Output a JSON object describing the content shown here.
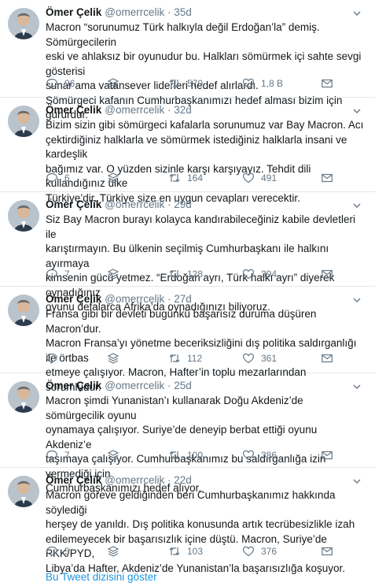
{
  "colors": {
    "link": "#1b95e0",
    "muted": "#657786",
    "text": "#14171a",
    "divider": "#e1e8ed"
  },
  "icons": {
    "reply": "reply-icon",
    "share": "stack-share-icon",
    "retweet": "retweet-icon",
    "like": "heart-icon",
    "message": "envelope-icon",
    "menu": "chevron-down-icon"
  },
  "tweets": [
    {
      "name": "Ömer Çelik",
      "handle": "@omerrcelik",
      "time": "35d",
      "text": "Macron “sorunumuz Türk halkıyla değil Erdoğan’la” demiş.  Sömürgecilerin\neski ve ahlaksız bir oyunudur bu. Halkları sömürmek içi sahte sevgi gösterisi\nsunar  ama vatansever liderleri hedef alırlardı.\nSömürgeci kafanın Cumhurbaşkanımızı hedef alması bizim için gururdur.",
      "replies": "96",
      "retweets": "570",
      "likes": "1,8 B"
    },
    {
      "name": "Ömer Çelik",
      "handle": "@omerrcelik",
      "time": "32d",
      "text": "Bizim sizin gibi sömürgeci kafalarla sorunumuz var Bay Macron. Acı\nçektirdiğiniz halklarla ve sömürmek istediğiniz halklarla insani ve kardeşlik\nbağımız var. O yüzden sizinle karşı karşıyayız. Tehdit dili kullandığınız ülke\nTürkiye’dir. Türkiye size en uygun cevapları verecektir.",
      "replies": "6",
      "retweets": "164",
      "likes": "491"
    },
    {
      "name": "Ömer Çelik",
      "handle": "@omerrcelik",
      "time": "29d",
      "text": "Siz Bay Macron burayı kolayca kandırabileceğiniz kabile devletleri ile\nkarıştırmayın. Bu ülkenin seçilmiş Cumhurbaşkanı ile halkını ayırmaya\nkimsenin gücü yetmez. “Erdoğan ayrı, Türk halkı ayrı” diyerek oynadığınız\noyunu defalarca Afrika’da oynadığınızı biliyoruz.",
      "replies": "7",
      "retweets": "128",
      "likes": "394"
    },
    {
      "name": "Ömer Çelik",
      "handle": "@omerrcelik",
      "time": "27d",
      "text": "Fransa gibi bir devleti bugünkü başarısız duruma düşüren Macron’dur.\nMacron Fransa’yı yönetme beceriksizliğini dış politika saldırganlığı ile örtbas\netmeye çalışıyor. Macron, Hafter’in toplu mezarlarından sorumludur.",
      "replies": "",
      "retweets": "112",
      "likes": "361"
    },
    {
      "name": "Ömer Çelik",
      "handle": "@omerrcelik",
      "time": "25d",
      "text": "Macron şimdi Yunanistan’ı kullanarak Doğu Akdeniz’de sömürgecilik oyunu\noynamaya çalışıyor. Suriye’de deneyip berbat ettiği oyunu Akdeniz’e\ntaşımaya çalışıyor. Cumhurbaşkanımız bu saldırganlığa izin vermediği için\nCumhurbaşkanımızı hedef alıyor.",
      "replies": "7",
      "retweets": "100",
      "likes": "386"
    },
    {
      "name": "Ömer Çelik",
      "handle": "@omerrcelik",
      "time": "22d",
      "text": "Macron göreve geldiğinden beri Cumhurbaşkanımız hakkında söylediği\nherşey de yanıldı. Dış politika konusunda artık tecrübesizlikle izah\nedilemeyecek bir başarısızlık içine düştü. Macron, Suriye’de PKK/PYD,\nLibya’da Hafter, Akdeniz’de Yunanistan’la başarısızlığa koşuyor.",
      "replies": "5",
      "retweets": "103",
      "likes": "376"
    }
  ],
  "thread_link": "Bu Tweet dizisini göster"
}
